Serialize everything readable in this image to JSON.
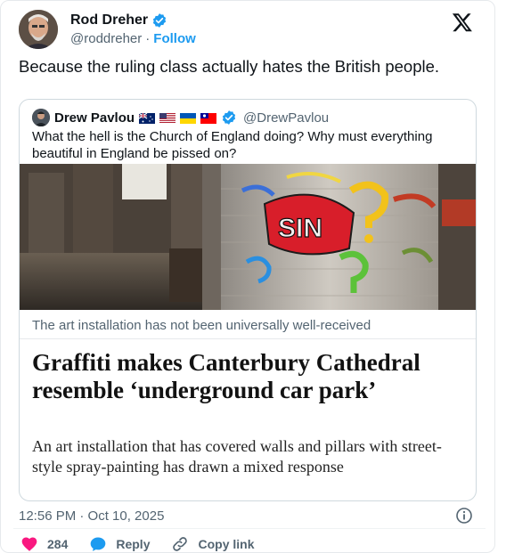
{
  "author": {
    "name": "Rod Dreher",
    "handle": "@roddreher",
    "separator": "·",
    "follow_label": "Follow"
  },
  "tweet": {
    "text": "Because the ruling class actually hates the British people."
  },
  "quoted": {
    "name": "Drew Pavlou",
    "handle": "@DrewPavlou",
    "flags": [
      "australia-flag",
      "usa-flag",
      "ukraine-flag",
      "taiwan-flag"
    ],
    "text": "What the hell is the Church of England doing? Why must everything beautiful in England be pissed on?",
    "article": {
      "image_caption": "The art installation has not been universally well-received",
      "headline": "Graffiti makes Canterbury Cathedral resemble ‘underground car park’",
      "standfirst": "An art installation that has covered walls and pillars with street-style spray-painting has drawn a mixed response",
      "graffiti_text": "SIN"
    }
  },
  "meta": {
    "timestamp": "12:56 PM · Oct 10, 2025"
  },
  "actions": {
    "like_count": "284",
    "reply_label": "Reply",
    "copy_link_label": "Copy link"
  },
  "colors": {
    "accent": "#1d9bf0",
    "like": "#f91880",
    "text": "#0f1419",
    "muted": "#536471"
  }
}
